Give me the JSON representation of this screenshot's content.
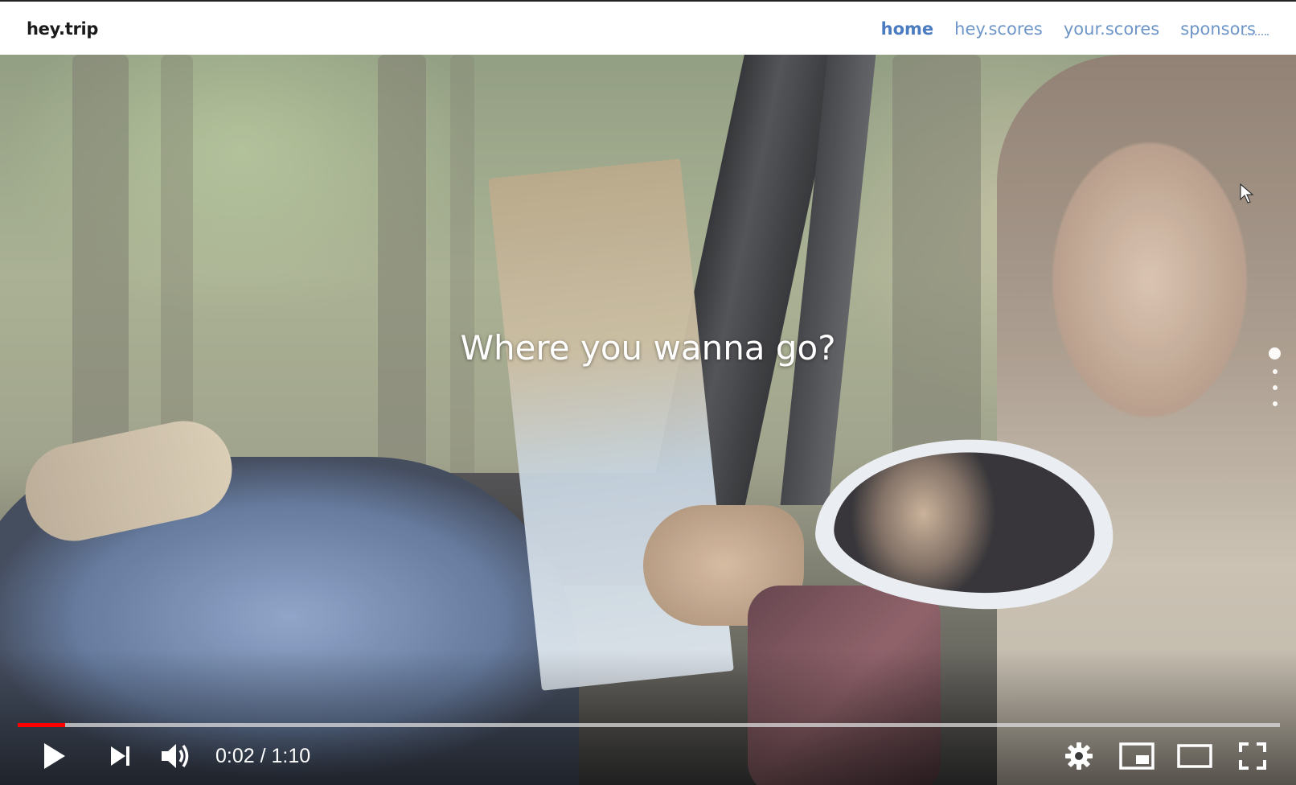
{
  "navbar": {
    "brand": "hey.trip",
    "links": [
      {
        "label": "home",
        "active": true
      },
      {
        "label": "hey.scores",
        "active": false
      },
      {
        "label": "your.scores",
        "active": false
      },
      {
        "label": "sponsors",
        "active": false
      }
    ]
  },
  "hero": {
    "headline": "Where you wanna go?",
    "page_dots": {
      "count": 4,
      "active_index": 0
    }
  },
  "player": {
    "current_time": "0:02",
    "duration": "1:10",
    "time_text": "0:02 / 1:10",
    "progress_fraction": 0.0375,
    "progress_color": "#ff0000",
    "icons": [
      "play-icon",
      "next-icon",
      "volume-icon",
      "settings-icon",
      "miniplayer-icon",
      "theater-mode-icon",
      "fullscreen-icon"
    ]
  },
  "colors": {
    "nav_link": "#6f96c8",
    "nav_link_active": "#4b7bc0"
  }
}
